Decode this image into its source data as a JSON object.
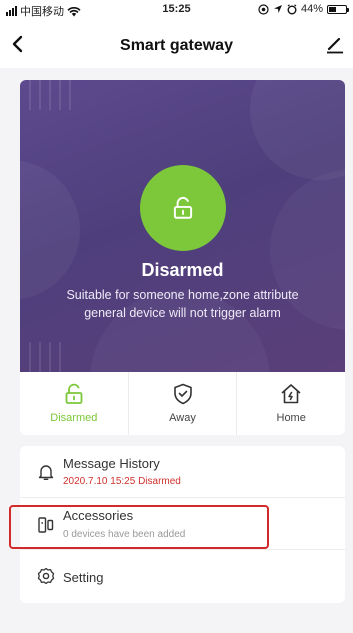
{
  "status_bar": {
    "carrier": "中国移动",
    "time": "15:25",
    "battery": "44%",
    "battery_level": 0.44
  },
  "nav": {
    "title": "Smart gateway"
  },
  "hero": {
    "state_title": "Disarmed",
    "description": "Suitable for someone home,zone attribute general device will not trigger alarm",
    "accent_color": "#7cc83a"
  },
  "modes": [
    {
      "label": "Disarmed",
      "icon": "unlock-icon",
      "active": true
    },
    {
      "label": "Away",
      "icon": "shield-check-icon",
      "active": false
    },
    {
      "label": "Home",
      "icon": "home-bolt-icon",
      "active": false
    }
  ],
  "menu": {
    "history": {
      "title": "Message History",
      "subtitle": "2020.7.10 15:25 Disarmed",
      "subtitle_color": "#d0312d"
    },
    "accessories": {
      "title": "Accessories",
      "subtitle": "0 devices have been added"
    },
    "setting": {
      "title": "Setting"
    }
  }
}
